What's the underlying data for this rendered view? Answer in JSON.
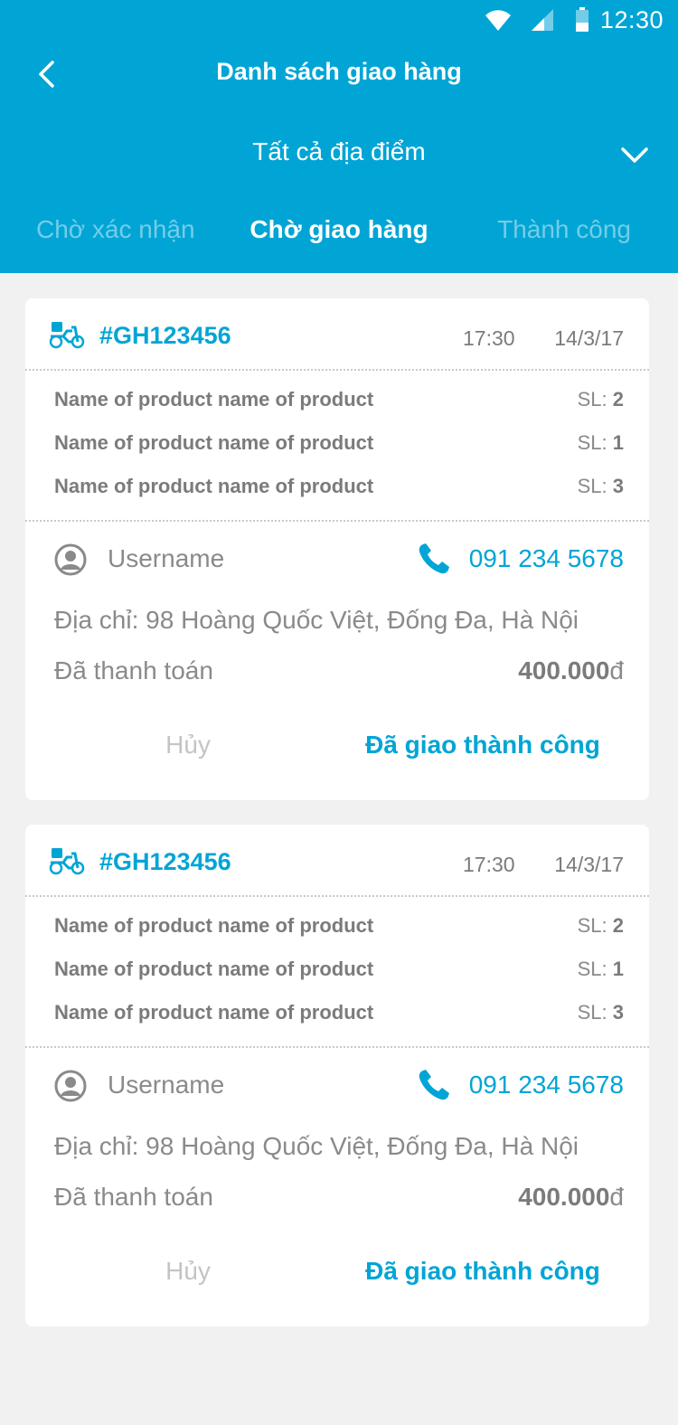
{
  "status_bar": {
    "time": "12:30",
    "icons": [
      "wifi-icon",
      "signal-icon",
      "battery-icon"
    ]
  },
  "header": {
    "title": "Danh sách giao hàng",
    "back_icon": "back-arrow-icon",
    "location_filter": {
      "label": "Tất cả địa điểm",
      "icon": "chevron-down-icon"
    },
    "tabs": [
      {
        "label": "Chờ xác nhận",
        "active": false
      },
      {
        "label": "Chờ giao hàng",
        "active": true
      },
      {
        "label": "Thành công",
        "active": false
      }
    ]
  },
  "colors": {
    "accent": "#00a5d5",
    "background": "#f1f1f1",
    "text": "#7b7b7b"
  },
  "orders": [
    {
      "id": "#GH123456",
      "time": "17:30",
      "date": "14/3/17",
      "products": [
        {
          "name": "Name of product name of product",
          "qty_label": "SL: ",
          "qty": "2"
        },
        {
          "name": "Name of product name of product",
          "qty_label": "SL: ",
          "qty": "1"
        },
        {
          "name": "Name of product name of product",
          "qty_label": "SL: ",
          "qty": "3"
        }
      ],
      "username": "Username",
      "phone": "091 234 5678",
      "address": "Địa chỉ: 98 Hoàng Quốc Việt, Đống Đa, Hà Nội",
      "paid_label": "Đã thanh toán",
      "paid_amount": "400.000",
      "currency": "đ",
      "cancel_label": "Hủy",
      "done_label": "Đã giao thành công"
    },
    {
      "id": "#GH123456",
      "time": "17:30",
      "date": "14/3/17",
      "products": [
        {
          "name": "Name of product name of product",
          "qty_label": "SL: ",
          "qty": "2"
        },
        {
          "name": "Name of product name of product",
          "qty_label": "SL: ",
          "qty": "1"
        },
        {
          "name": "Name of product name of product",
          "qty_label": "SL: ",
          "qty": "3"
        }
      ],
      "username": "Username",
      "phone": "091 234 5678",
      "address": "Địa chỉ: 98 Hoàng Quốc Việt, Đống Đa, Hà Nội",
      "paid_label": "Đã thanh toán",
      "paid_amount": "400.000",
      "currency": "đ",
      "cancel_label": "Hủy",
      "done_label": "Đã giao thành công"
    }
  ]
}
